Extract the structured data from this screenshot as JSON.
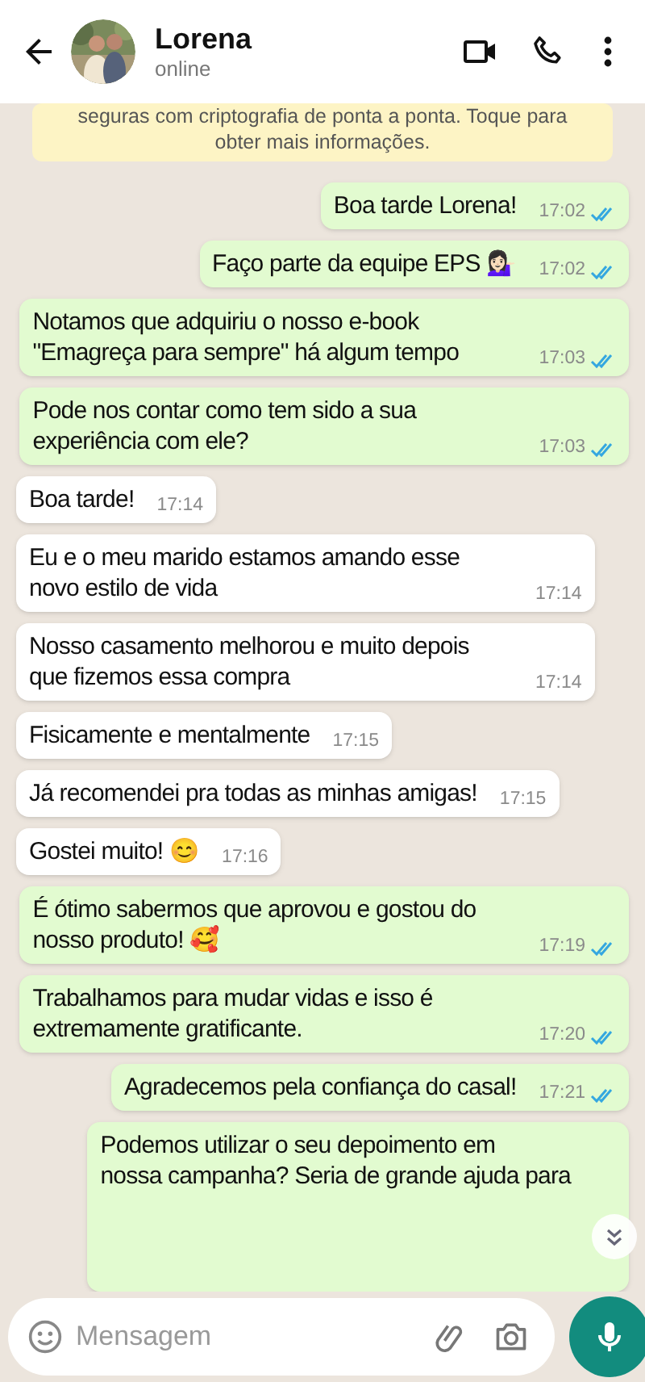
{
  "header": {
    "name": "Lorena",
    "status": "online"
  },
  "banner": {
    "lines": [
      "seguras com criptografia de ponta a ponta. Toque para",
      "obter mais informações."
    ]
  },
  "messages": [
    {
      "kind": "out",
      "text": "Boa tarde Lorena!",
      "time": "17:02",
      "read": true
    },
    {
      "kind": "out",
      "text": "Faço parte da equipe EPS 💁🏻‍♀️",
      "time": "17:02",
      "read": true
    },
    {
      "kind": "out",
      "text": "Notamos que adquiriu o nosso e-book \"Emagreça para sempre\" há algum tempo",
      "time": "17:03",
      "read": true
    },
    {
      "kind": "out",
      "text": "Pode nos contar como tem sido a sua experiência com ele?",
      "time": "17:03",
      "read": true
    },
    {
      "kind": "in",
      "text": "Boa tarde!",
      "time": "17:14"
    },
    {
      "kind": "in",
      "text": "Eu e o meu marido estamos amando esse novo estilo de vida",
      "time": "17:14"
    },
    {
      "kind": "in",
      "text": "Nosso casamento melhorou e muito depois que fizemos essa compra",
      "time": "17:14"
    },
    {
      "kind": "in",
      "text": "Fisicamente e mentalmente",
      "time": "17:15"
    },
    {
      "kind": "in",
      "text": "Já recomendei pra todas as minhas amigas!",
      "time": "17:15"
    },
    {
      "kind": "in",
      "text": "Gostei muito! 😊",
      "time": "17:16"
    },
    {
      "kind": "out",
      "text": "É ótimo sabermos que aprovou e gostou do nosso produto! 🥰",
      "time": "17:19",
      "read": true
    },
    {
      "kind": "out",
      "text": "Trabalhamos para mudar vidas e isso é extremamente gratificante.",
      "time": "17:20",
      "read": true
    },
    {
      "kind": "out",
      "text": "Agradecemos pela confiança do casal!",
      "time": "17:21",
      "read": true
    },
    {
      "kind": "out",
      "text": "Podemos utilizar o seu depoimento em\nnossa campanha? Seria de grande ajuda para"
    }
  ],
  "composer": {
    "placeholder": "Mensagem"
  }
}
